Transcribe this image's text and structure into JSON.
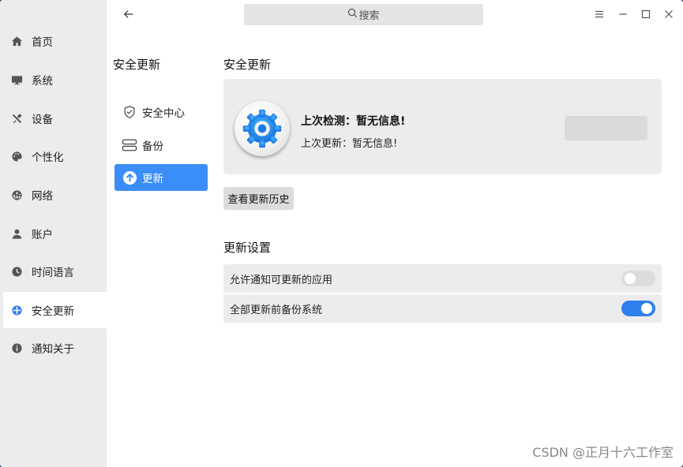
{
  "search": {
    "label": "搜索"
  },
  "sidebar": {
    "items": [
      {
        "label": "首页",
        "icon": "home-icon"
      },
      {
        "label": "系统",
        "icon": "monitor-icon"
      },
      {
        "label": "设备",
        "icon": "tools-icon"
      },
      {
        "label": "个性化",
        "icon": "palette-icon"
      },
      {
        "label": "网络",
        "icon": "globe-icon"
      },
      {
        "label": "账户",
        "icon": "user-icon"
      },
      {
        "label": "时间语言",
        "icon": "clock-icon"
      },
      {
        "label": "安全更新",
        "icon": "security-icon",
        "active": true
      },
      {
        "label": "通知关于",
        "icon": "info-icon"
      }
    ]
  },
  "subnav": {
    "title": "安全更新",
    "items": [
      {
        "label": "安全中心",
        "icon": "shield-icon"
      },
      {
        "label": "备份",
        "icon": "backup-icon"
      },
      {
        "label": "更新",
        "icon": "update-arrow-icon",
        "active": true
      }
    ]
  },
  "main": {
    "title": "安全更新",
    "status": {
      "last_check": "上次检测：暂无信息!",
      "last_update": "上次更新：暂无信息!"
    },
    "history_button": "查看更新历史",
    "settings_title": "更新设置",
    "settings": [
      {
        "label": "允许通知可更新的应用",
        "enabled": false
      },
      {
        "label": "全部更新前备份系统",
        "enabled": true
      }
    ]
  },
  "watermark": "CSDN @正月十六工作室",
  "colors": {
    "accent": "#3b8ef7",
    "sidebar_bg": "#ececec",
    "card_bg": "#ececec"
  }
}
